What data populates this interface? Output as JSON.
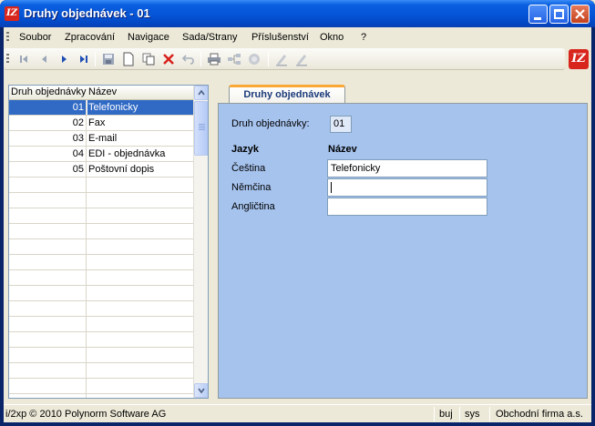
{
  "window": {
    "title": "Druhy objednávek - 01",
    "app_icon_text": "IZ",
    "minimize_label": "minimize",
    "maximize_label": "maximize",
    "close_label": "close"
  },
  "menu": {
    "items": [
      "Soubor",
      "Zpracování",
      "Navigace",
      "Sada/Strany",
      "Příslušenství",
      "Okno",
      "?"
    ]
  },
  "toolbar": {
    "logo_text": "IZ",
    "icons": [
      "first-record-icon",
      "previous-record-icon",
      "next-record-icon",
      "last-record-icon",
      "save-icon",
      "new-document-icon",
      "copy-icon",
      "delete-icon",
      "undo-icon",
      "print-icon",
      "tree-icon",
      "stop-icon",
      "edit-icon",
      "edit-alt-icon"
    ]
  },
  "list": {
    "columns": [
      "Druh objednávky",
      "Název"
    ],
    "rows": [
      {
        "code": "01",
        "name": "Telefonicky",
        "selected": true
      },
      {
        "code": "02",
        "name": "Fax",
        "selected": false
      },
      {
        "code": "03",
        "name": "E-mail",
        "selected": false
      },
      {
        "code": "04",
        "name": "EDI - objednávka",
        "selected": false
      },
      {
        "code": "05",
        "name": "Poštovní dopis",
        "selected": false
      }
    ],
    "empty_rows": 17
  },
  "detail": {
    "tab_label": "Druhy objednávek",
    "type_label": "Druh objednávky:",
    "type_value": "01",
    "col_language": "Jazyk",
    "col_name": "Název",
    "languages": [
      {
        "label": "Čeština",
        "value": "Telefonicky"
      },
      {
        "label": "Němčina",
        "value": ""
      },
      {
        "label": "Angličtina",
        "value": ""
      }
    ]
  },
  "status": {
    "copyright": "i/2xp © 2010 Polynorm Software AG",
    "user": "buj",
    "system": "sys",
    "company": "Obchodní firma a.s."
  },
  "colors": {
    "title_bar": "#0554d6",
    "selection": "#316ac5",
    "panel": "#a6c3ee",
    "tab_accent": "#f9a835",
    "logo": "#d8261d"
  }
}
